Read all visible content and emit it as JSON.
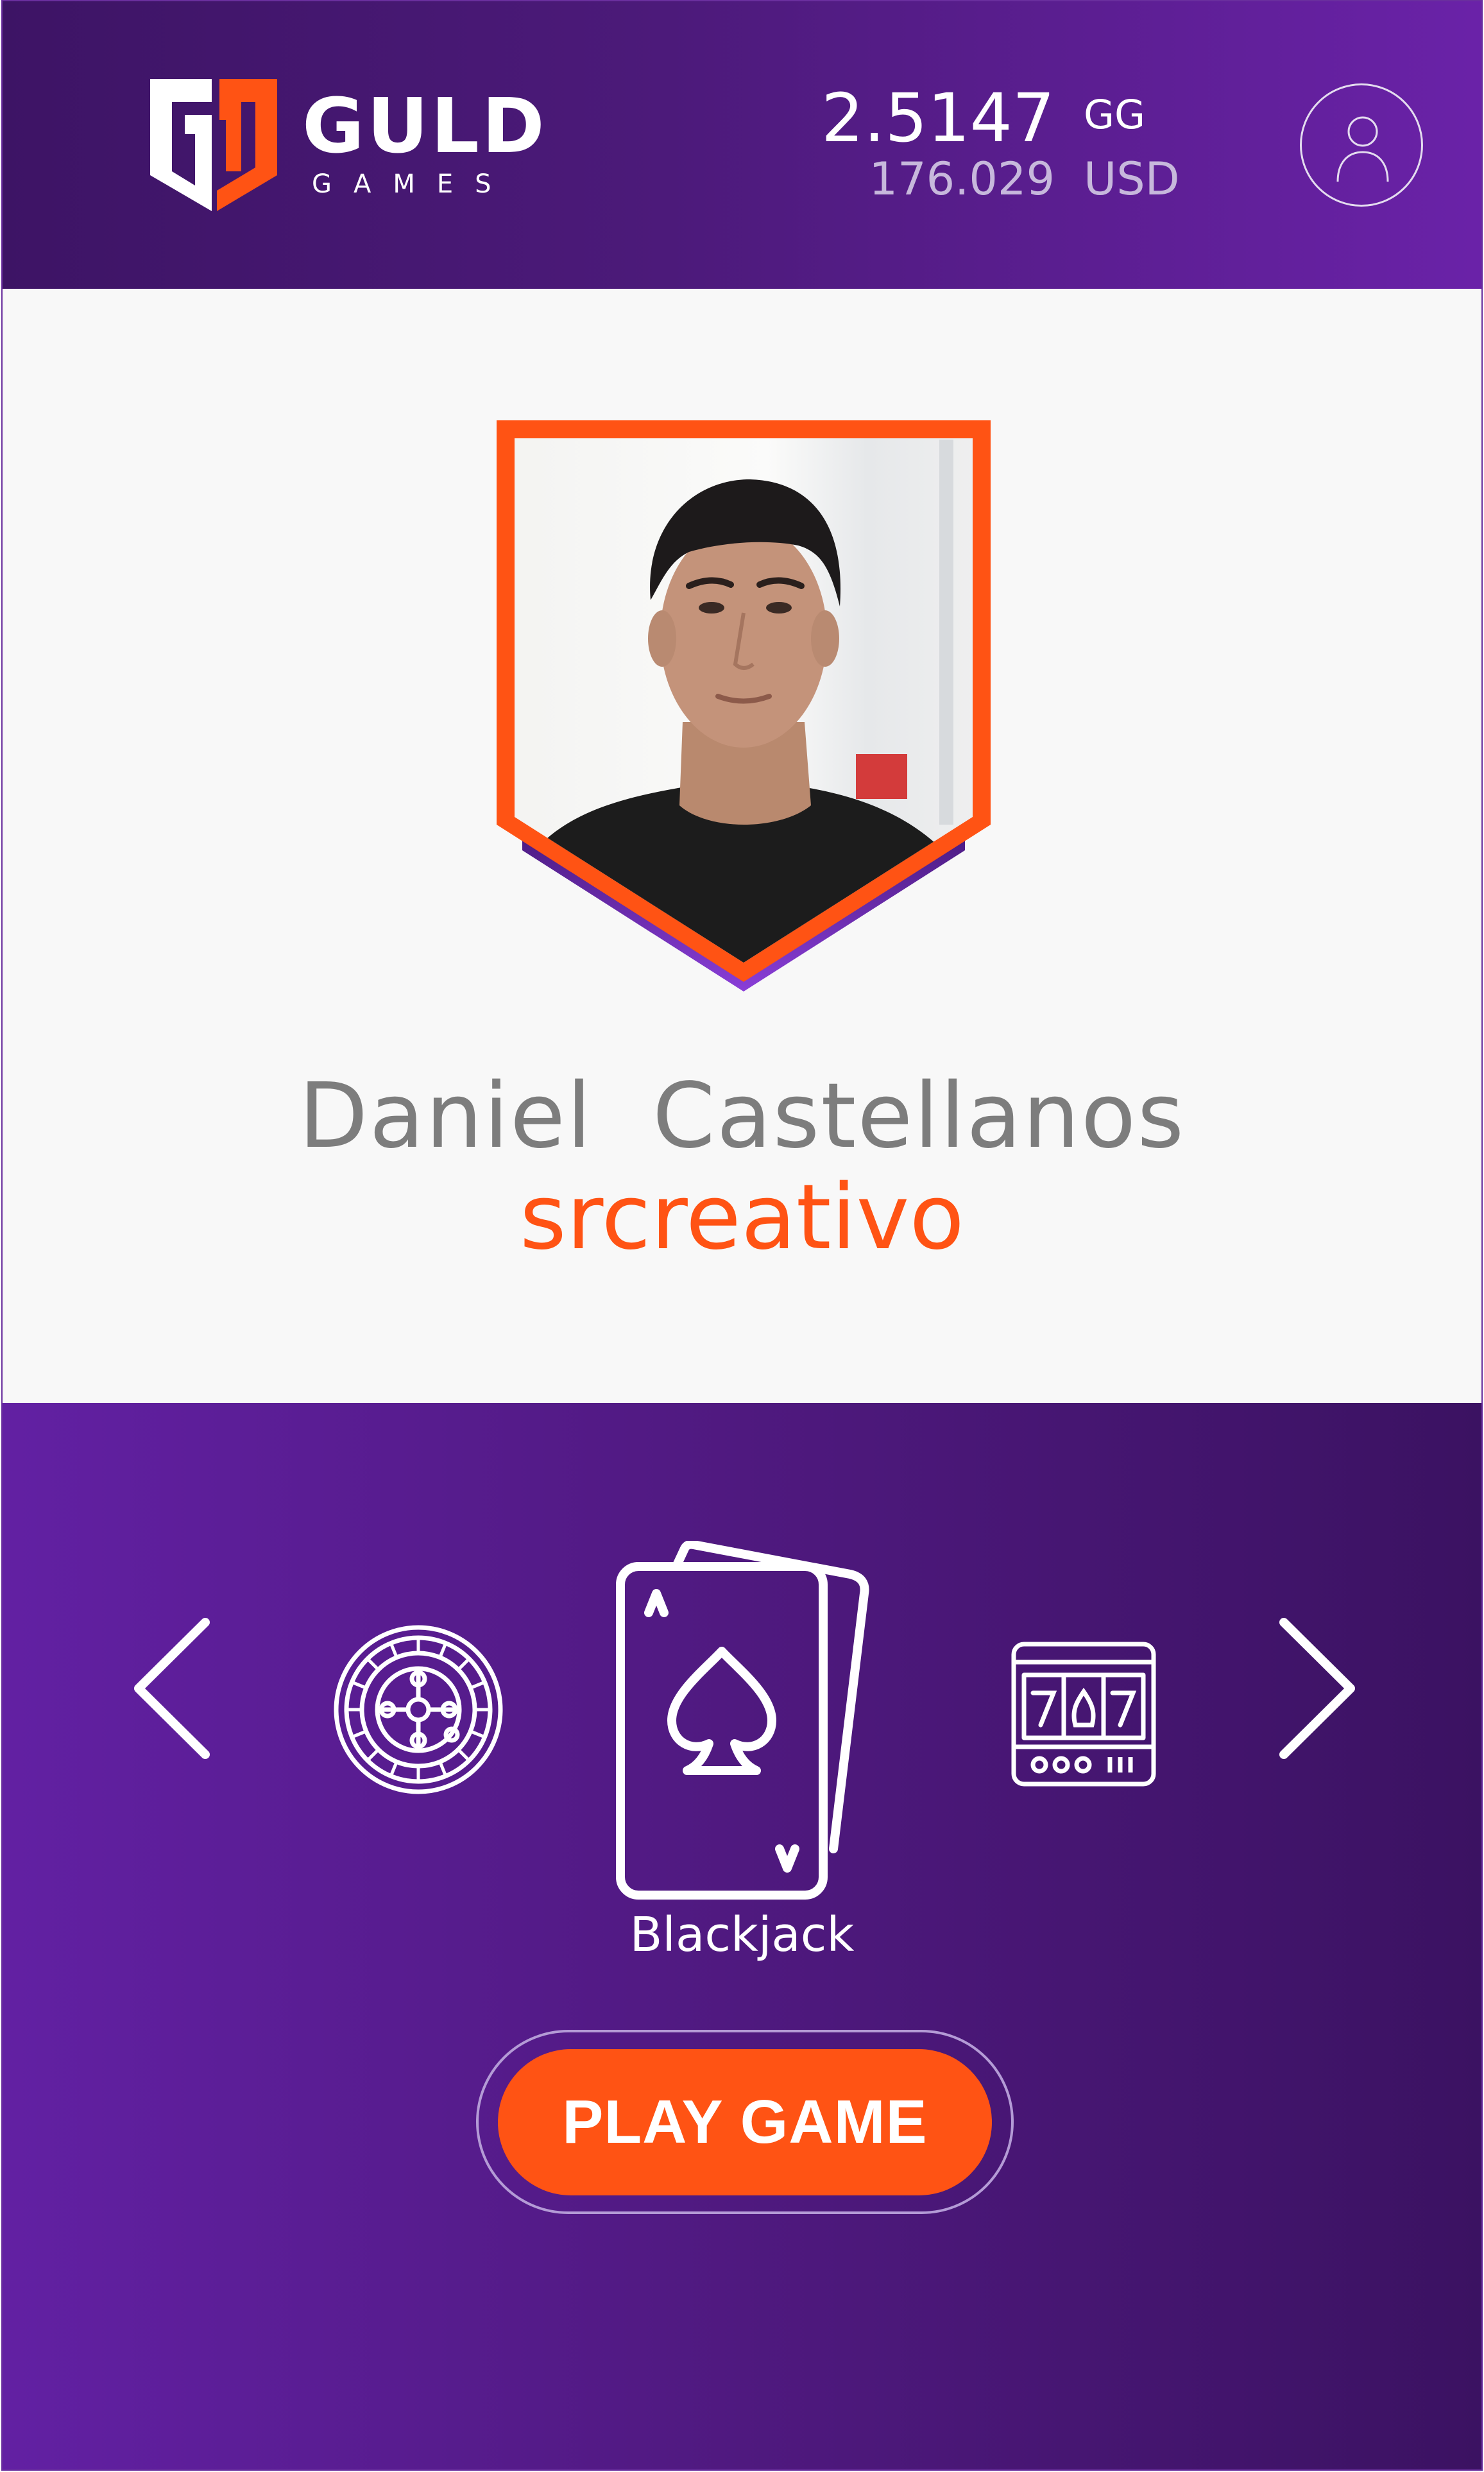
{
  "header": {
    "logo_title": "GULD",
    "logo_subtitle": "GAMES",
    "balance_gg_value": "2.5147",
    "balance_gg_unit": "GG",
    "balance_usd_value": "176.029",
    "balance_usd_unit": "USD",
    "profile_icon": "user-icon"
  },
  "profile": {
    "full_name": "Daniel  Castellanos",
    "username": "srcreativo"
  },
  "games": {
    "items": [
      {
        "icon": "roulette-icon"
      },
      {
        "icon": "blackjack-cards-icon",
        "label": "Blackjack"
      },
      {
        "icon": "slot-machine-icon"
      }
    ],
    "selected_label": "Blackjack",
    "play_label": "PLAY GAME"
  },
  "colors": {
    "purple_dark": "#3d1465",
    "purple_light": "#6a22a8",
    "orange": "#ff5314",
    "profile_bg": "#f8f8f8"
  }
}
